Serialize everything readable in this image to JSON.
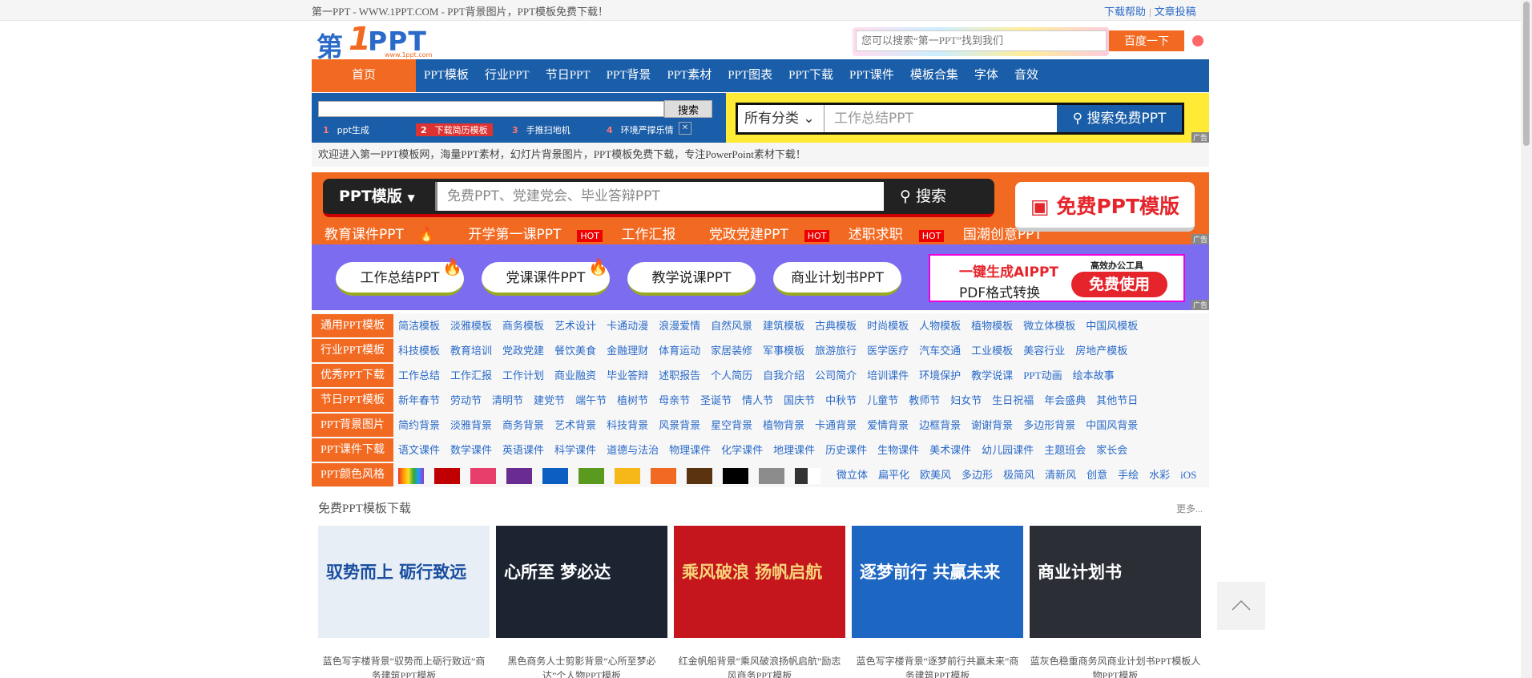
{
  "topbar": {
    "slogan": "第一PPT - WWW.1PPT.COM - PPT背景图片，PPT模板免费下载！",
    "link_help": "下载帮助",
    "sep": "|",
    "link_submit": "文章投稿"
  },
  "logo": {
    "char": "第",
    "one": "1",
    "ppt": "PPT",
    "url": "www.1ppt.com"
  },
  "header_search": {
    "placeholder": "您可以搜索“第一PPT”找到我们",
    "button": "百度一下"
  },
  "nav": {
    "home": "首页",
    "items": [
      "PPT模板",
      "行业PPT",
      "节日PPT",
      "PPT背景",
      "PPT素材",
      "PPT图表",
      "PPT下载",
      "PPT课件",
      "模板合集",
      "字体",
      "音效"
    ]
  },
  "ad_left": {
    "button": "搜索",
    "hints": [
      {
        "n": "1",
        "t": "ppt生成"
      },
      {
        "n": "2",
        "t": "下载简历模板"
      },
      {
        "n": "3",
        "t": "手推扫地机"
      },
      {
        "n": "4",
        "t": "环境严撑乐情"
      }
    ],
    "close": "✕"
  },
  "ad_right": {
    "category": "所有分类",
    "placeholder": "工作总结PPT",
    "button": "搜索免费PPT",
    "tag": "广告"
  },
  "welcome": "欢迎进入第一PPT模板网，海量PPT素材，幻灯片背景图片，PPT模板免费下载，专注PowerPoint素材下载！",
  "ad2": {
    "select": "PPT模版",
    "placeholder": "免费PPT、党建党会、毕业答辩PPT",
    "search": "搜索",
    "tags": [
      {
        "t": "教育课件PPT",
        "hot": ""
      },
      {
        "t": "开学第一课PPT",
        "hot": "HOT"
      },
      {
        "t": "工作汇报",
        "hot": ""
      },
      {
        "t": "党政党建PPT",
        "hot": "HOT"
      },
      {
        "t": "述职求职",
        "hot": "HOT"
      },
      {
        "t": "国潮创意PPT",
        "hot": ""
      }
    ],
    "free": "免费PPT模版",
    "tag": "广告"
  },
  "ad3": {
    "pills": [
      "工作总结PPT",
      "党课课件PPT",
      "教学说课PPT",
      "商业计划书PPT"
    ],
    "promo_a": "一键生成AIPPT",
    "promo_b": "PDF格式转换",
    "promo_c": "高效办公工具",
    "promo_d": "免费使用",
    "tag": "广告"
  },
  "categories": [
    {
      "label": "通用PPT模板",
      "items": [
        "简洁模板",
        "淡雅模板",
        "商务模板",
        "艺术设计",
        "卡通动漫",
        "浪漫爱情",
        "自然风景",
        "建筑模板",
        "古典模板",
        "时尚模板",
        "人物模板",
        "植物模板",
        "微立体模板",
        "中国风模板"
      ]
    },
    {
      "label": "行业PPT模板",
      "items": [
        "科技模板",
        "教育培训",
        "党政党建",
        "餐饮美食",
        "金融理财",
        "体育运动",
        "家居装修",
        "军事模板",
        "旅游旅行",
        "医学医疗",
        "汽车交通",
        "工业模板",
        "美容行业",
        "房地产模板"
      ]
    },
    {
      "label": "优秀PPT下载",
      "items": [
        "工作总结",
        "工作汇报",
        "工作计划",
        "商业融资",
        "毕业答辩",
        "述职报告",
        "个人简历",
        "自我介绍",
        "公司简介",
        "培训课件",
        "环境保护",
        "教学说课",
        "PPT动画",
        "绘本故事"
      ]
    },
    {
      "label": "节日PPT模板",
      "items": [
        "新年春节",
        "劳动节",
        "清明节",
        "建党节",
        "端午节",
        "植树节",
        "母亲节",
        "圣诞节",
        "情人节",
        "国庆节",
        "中秋节",
        "儿童节",
        "教师节",
        "妇女节",
        "生日祝福",
        "年会盛典",
        "其他节日"
      ]
    },
    {
      "label": "PPT背景图片",
      "items": [
        "简约背景",
        "淡雅背景",
        "商务背景",
        "艺术背景",
        "科技背景",
        "风景背景",
        "星空背景",
        "植物背景",
        "卡通背景",
        "爱情背景",
        "边框背景",
        "谢谢背景",
        "多边形背景",
        "中国风背景"
      ]
    },
    {
      "label": "PPT课件下载",
      "items": [
        "语文课件",
        "数学课件",
        "英语课件",
        "科学课件",
        "道德与法治",
        "物理课件",
        "化学课件",
        "地理课件",
        "历史课件",
        "生物课件",
        "美术课件",
        "幼儿园课件",
        "主题班会",
        "家长会"
      ]
    }
  ],
  "color_row": {
    "label": "PPT颜色风格",
    "swatches": [
      "#c00000",
      "#e83e6c",
      "#6b2c91",
      "#0b5fc2",
      "#5a9a1e",
      "#f6b818",
      "#f26a21",
      "#5c3310",
      "#000000",
      "#8c8c8c",
      "#333333"
    ],
    "styles": [
      "微立体",
      "扁平化",
      "欧美风",
      "多边形",
      "极简风",
      "清新风",
      "创意",
      "手绘",
      "水彩",
      "iOS"
    ]
  },
  "section": {
    "title": "免费PPT模板下载",
    "more": "更多..."
  },
  "thumbs": [
    {
      "bg": "#e8eef5",
      "headline": "驭势而上 砺行致远",
      "color": "#1a4fa0",
      "caption": "蓝色写字楼背景“驭势而上砺行致远”商务建筑PPT模板"
    },
    {
      "bg": "#1b2430",
      "headline": "心所至 梦必达",
      "color": "#ffffff",
      "caption": "黑色商务人士剪影背景“心所至梦必达”个人物PPT模板"
    },
    {
      "bg": "#c4161c",
      "headline": "乘风破浪 扬帆启航",
      "color": "#f6d37a",
      "caption": "红金帆船背景“乘风破浪扬帆启航”励志风商务PPT模板"
    },
    {
      "bg": "#1d66c2",
      "headline": "逐梦前行 共赢未来",
      "color": "#ffffff",
      "caption": "蓝色写字楼背景“逐梦前行共赢未来”商务建筑PPT模板"
    },
    {
      "bg": "#2b2f35",
      "headline": "商业计划书",
      "color": "#ffffff",
      "caption": "蓝灰色稳重商务风商业计划书PPT模板人物PPT模板"
    }
  ]
}
